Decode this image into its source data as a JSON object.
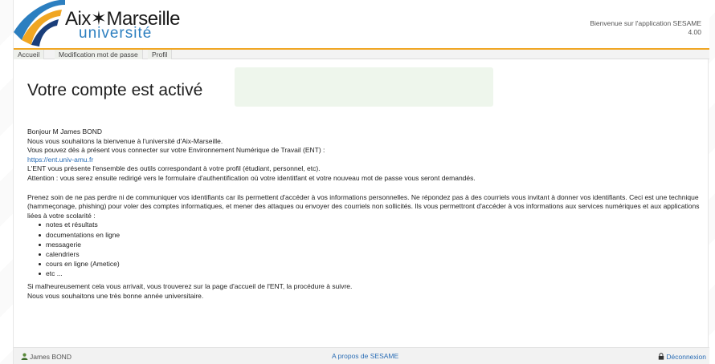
{
  "header": {
    "logo_line1": "Aix✶Marseille",
    "logo_line2": "université",
    "welcome_line1": "Bienvenue sur l'application SESAME",
    "welcome_line2": "4.00"
  },
  "nav": {
    "items": [
      {
        "label": "Accueil"
      },
      {
        "label": "Modification mot de passe"
      },
      {
        "label": "Profil"
      }
    ]
  },
  "main": {
    "title": "Votre compte est activé",
    "paragraph1": [
      "Bonjour M James BOND",
      "Nous vous souhaitons la bienvenue à l'université d'Aix-Marseille.",
      "Vous pouvez dès à présent vous connecter sur votre Environnement Numérique de Travail (ENT) :"
    ],
    "ent_link": "https://ent.univ-amu.fr",
    "paragraph1b": [
      "L'ENT vous présente l'ensemble des outils correspondant à votre profil (étudiant, personnel, etc).",
      "Attention : vous serez ensuite redirigé vers le formulaire d'authentification où votre identitfant et votre nouveau mot de passe vous seront demandés."
    ],
    "paragraph2": "Prenez soin de ne pas perdre ni de communiquer vos identifiants car ils permettent d'accéder à vos informations personnelles. Ne répondez pas à des courriels vous invitant à donner vos identifiants. Ceci est une technique (hammeçonage, phishing) pour voler des comptes informatiques, et mener des attaques ou envoyer des courriels non sollicités. Ils vous permettront d'accéder à vos informations aux services numériques et aux applications liées à votre scolarité :",
    "services": [
      "notes et résultats",
      "documentations en ligne",
      "messagerie",
      "calendriers",
      "cours en ligne (Ametice)",
      "etc ..."
    ],
    "closing1": "Si malheureusement cela vous arrivait, vous trouverez sur la page d'accueil de l'ENT, la procédure à suivre.",
    "closing2": "Nous vous souhaitons une très bonne année universitaire."
  },
  "footer": {
    "user": "James BOND",
    "about": "A propos de SESAME",
    "logout": "Déconnexion",
    "user_icon": "user-icon",
    "logout_icon": "lock-icon"
  },
  "colors": {
    "accent_orange": "#f0a623",
    "brand_blue": "#2c7fc0",
    "link_blue": "#2a6db5"
  }
}
